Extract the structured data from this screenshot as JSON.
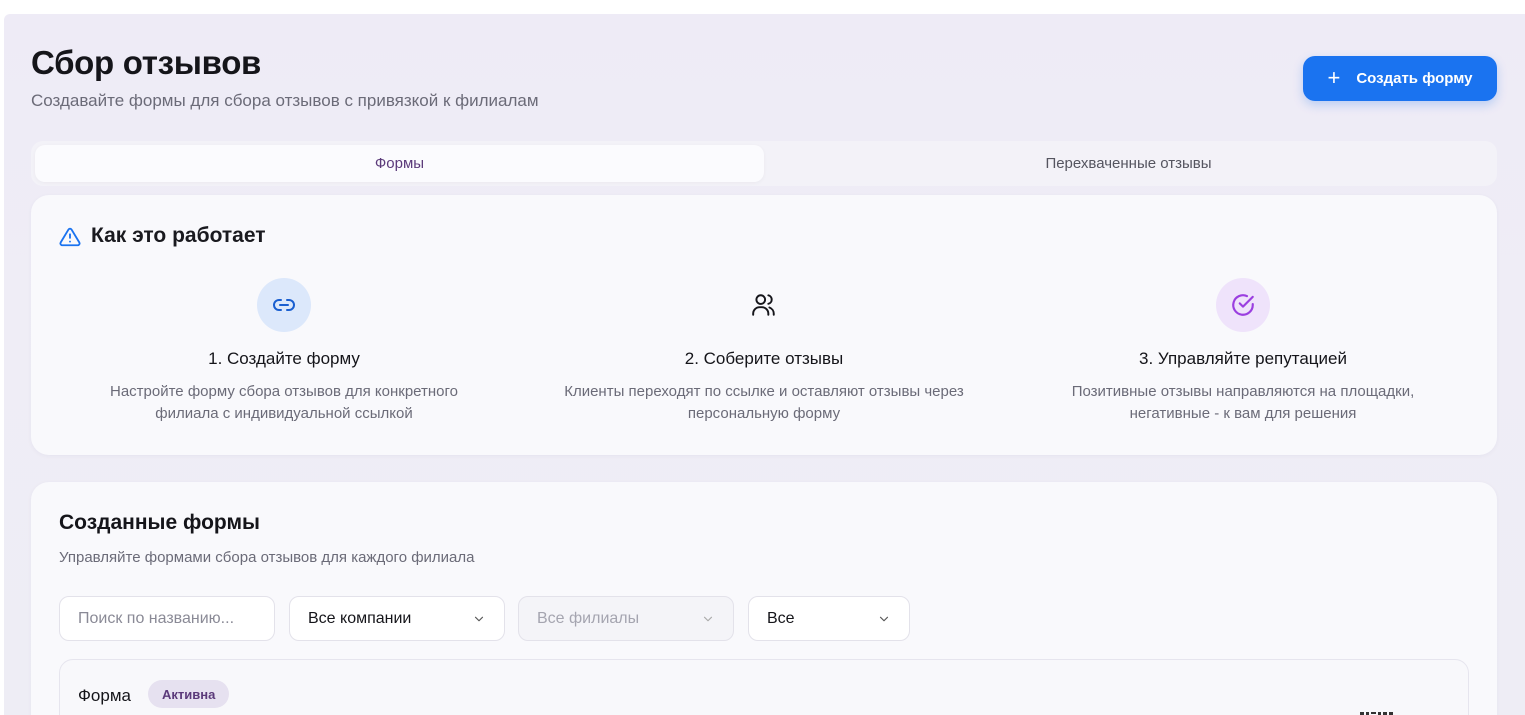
{
  "header": {
    "title": "Сбор отзывов",
    "subtitle": "Создавайте формы для сбора отзывов с привязкой к филиалам",
    "create_button_icon": "plus-icon",
    "create_button_label": "Создать форму"
  },
  "tabs": [
    {
      "label": "Формы",
      "active": true
    },
    {
      "label": "Перехваченные отзывы",
      "active": false
    }
  ],
  "how_it_works": {
    "icon": "warning-triangle-icon",
    "title": "Как это работает",
    "steps": [
      {
        "icon": "link-icon",
        "title": "1. Создайте форму",
        "desc_line1": "Настройте форму сбора отзывов для конкретного",
        "desc_line2": "филиала с индивидуальной ссылкой"
      },
      {
        "icon": "users-icon",
        "title": "2. Соберите отзывы",
        "desc_line1": "Клиенты переходят по ссылке и оставляют отзывы через",
        "desc_line2": "персональную форму"
      },
      {
        "icon": "check-circle-icon",
        "title": "3. Управляйте репутацией",
        "desc_line1": "Позитивные отзывы направляются на площадки,",
        "desc_line2": "негативные - к вам для решения"
      }
    ]
  },
  "forms_section": {
    "title": "Созданные формы",
    "subtitle": "Управляйте формами сбора отзывов для каждого филиала",
    "search_placeholder": "Поиск по названию...",
    "filter_company": "Все компании",
    "filter_branch": "Все филиалы",
    "filter_status": "Все",
    "items": [
      {
        "name": "Форма",
        "status": "Активна"
      }
    ]
  },
  "colors": {
    "accent": "#1a73f0",
    "active_tab_text": "#5b3a7a",
    "link_circle": "#dce8fb",
    "check_circle": "#efe3fb"
  }
}
